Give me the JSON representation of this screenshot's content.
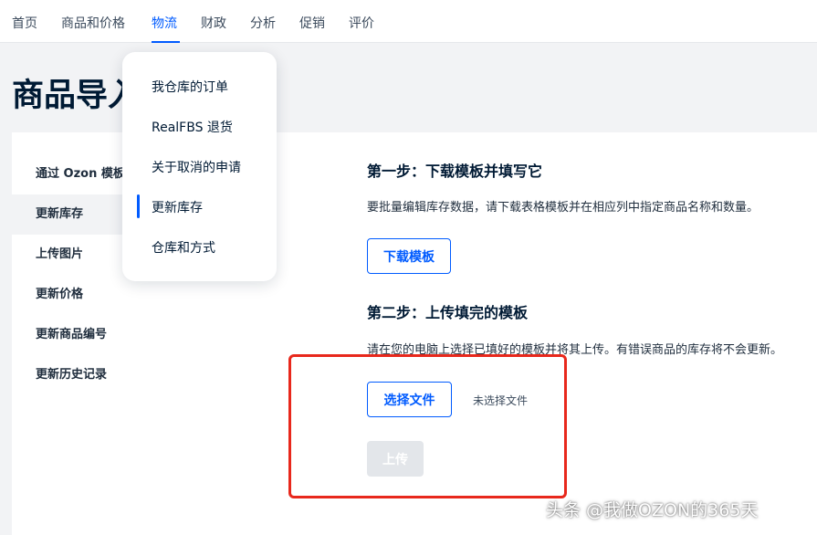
{
  "nav": {
    "items": [
      "首页",
      "商品和价格",
      "物流",
      "财政",
      "分析",
      "促销",
      "评价"
    ],
    "active_index": 2
  },
  "page": {
    "title": "商品导入"
  },
  "sidebar": {
    "items": [
      "通过 Ozon 模板",
      "更新库存",
      "上传图片",
      "更新价格",
      "更新商品编号",
      "更新历史记录"
    ],
    "active_index": 1
  },
  "dropdown": {
    "items": [
      "我仓库的订单",
      "RealFBS 退货",
      "关于取消的申请",
      "更新库存",
      "仓库和方式"
    ],
    "active_index": 3
  },
  "step1": {
    "heading": "第一步：下载模板并填写它",
    "description": "要批量编辑库存数据，请下载表格模板并在相应列中指定商品名称和数量。",
    "button": "下载模板"
  },
  "step2": {
    "heading": "第二步：上传填完的模板",
    "description": "请在您的电脑上选择已填好的模板并将其上传。有错误商品的库存将不会更新。",
    "choose_button": "选择文件",
    "no_file_text": "未选择文件",
    "upload_button": "上传"
  },
  "watermark": "头条 @我做OZON的365天",
  "colors": {
    "accent": "#005bff",
    "annotation": "#e8281c",
    "disabled": "#e3e6ea"
  }
}
